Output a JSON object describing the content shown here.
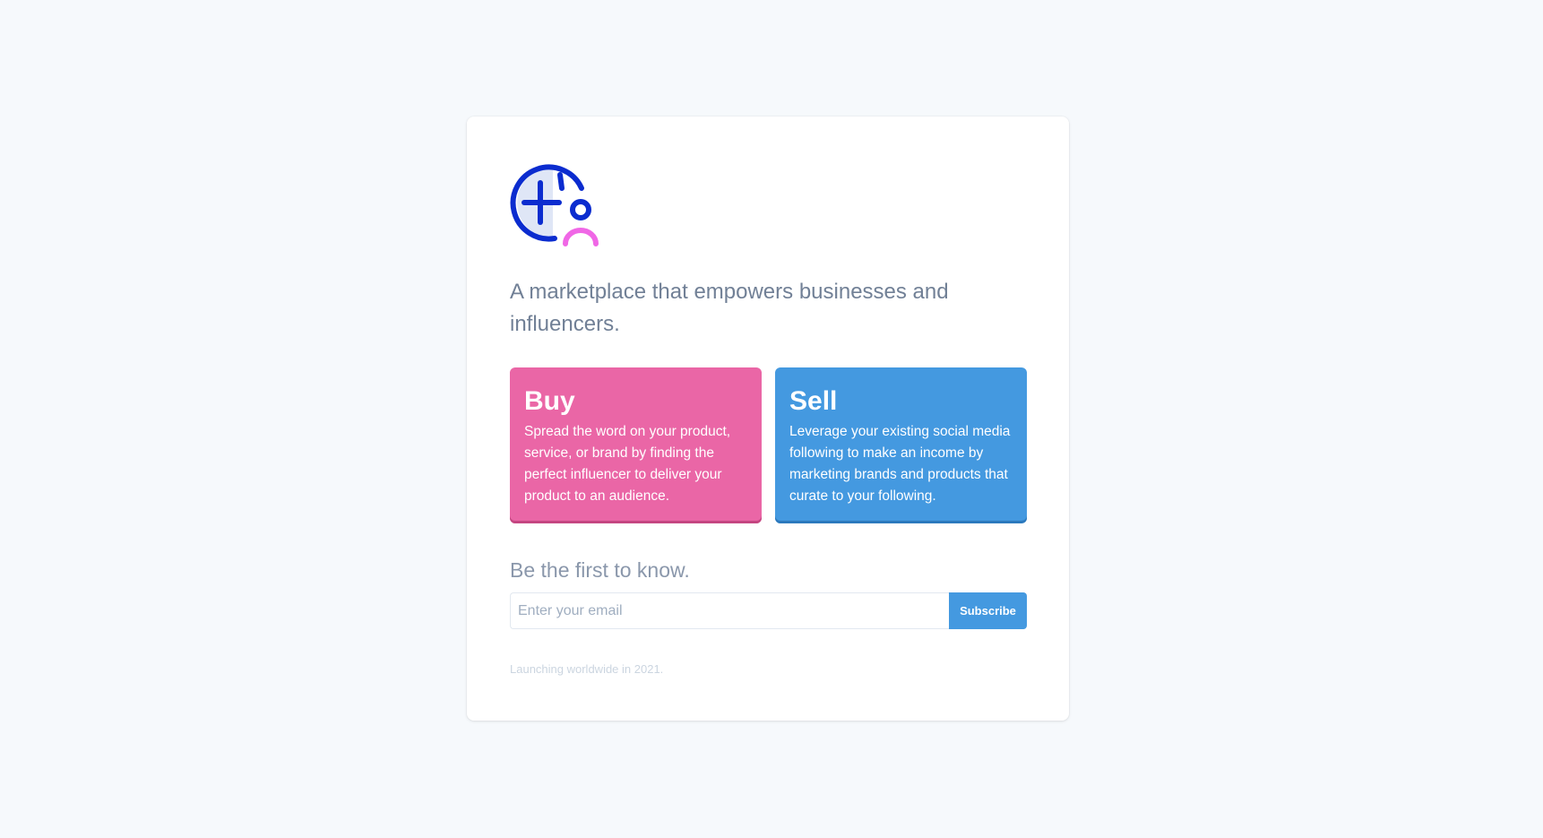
{
  "brand": {
    "logo_icon": "globe-person-logo-icon",
    "colors": {
      "logo_primary": "#0b2ccf",
      "logo_accent": "#f067e6",
      "buy": "#ea66a6",
      "sell": "#4499e0"
    }
  },
  "tagline": "A marketplace that empowers businesses and influencers.",
  "tiles": [
    {
      "title": "Buy",
      "description": "Spread the word on your product, service, or brand by finding the perfect influencer to deliver your product to an audience."
    },
    {
      "title": "Sell",
      "description": "Leverage your existing social media following to make an income by marketing brands and products that curate to your following."
    }
  ],
  "notify": {
    "heading": "Be the first to know.",
    "email_placeholder": "Enter your email",
    "email_value": "",
    "button_label": "Subscribe"
  },
  "footnote": "Launching worldwide in 2021."
}
